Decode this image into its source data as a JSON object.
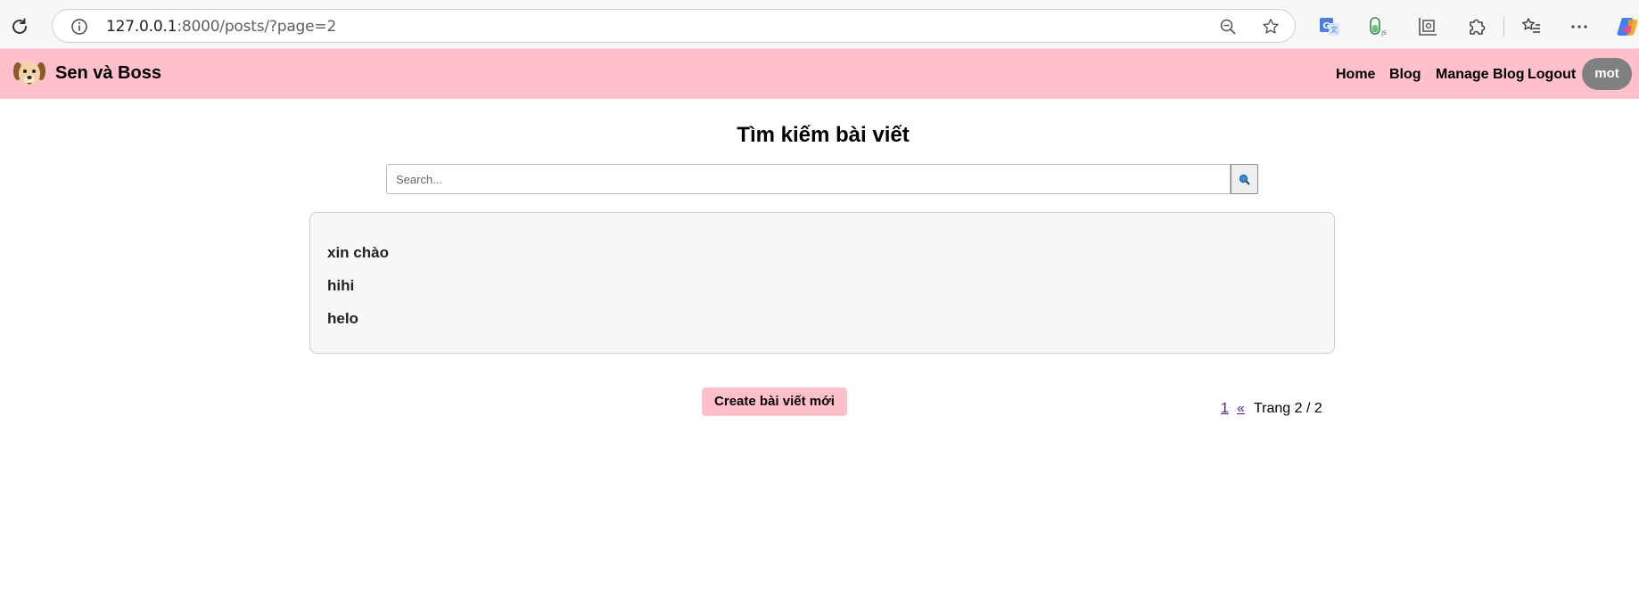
{
  "browser": {
    "url_host": "127.0.0.1",
    "url_rest": ":8000/posts/?page=2"
  },
  "navbar": {
    "brand": "Sen và Boss",
    "links": [
      "Home",
      "Blog",
      "Manage Blog",
      "Logout"
    ],
    "user": "mot",
    "color": "#ffc0cb"
  },
  "main": {
    "title": "Tìm kiếm bài viết",
    "search_placeholder": "Search...",
    "results": [
      "xin chào",
      "hihi",
      "helo"
    ],
    "create_button": "Create bài viết mới",
    "pagination": {
      "first": "1",
      "prev": "«",
      "info": "Trang 2 / 2"
    }
  }
}
